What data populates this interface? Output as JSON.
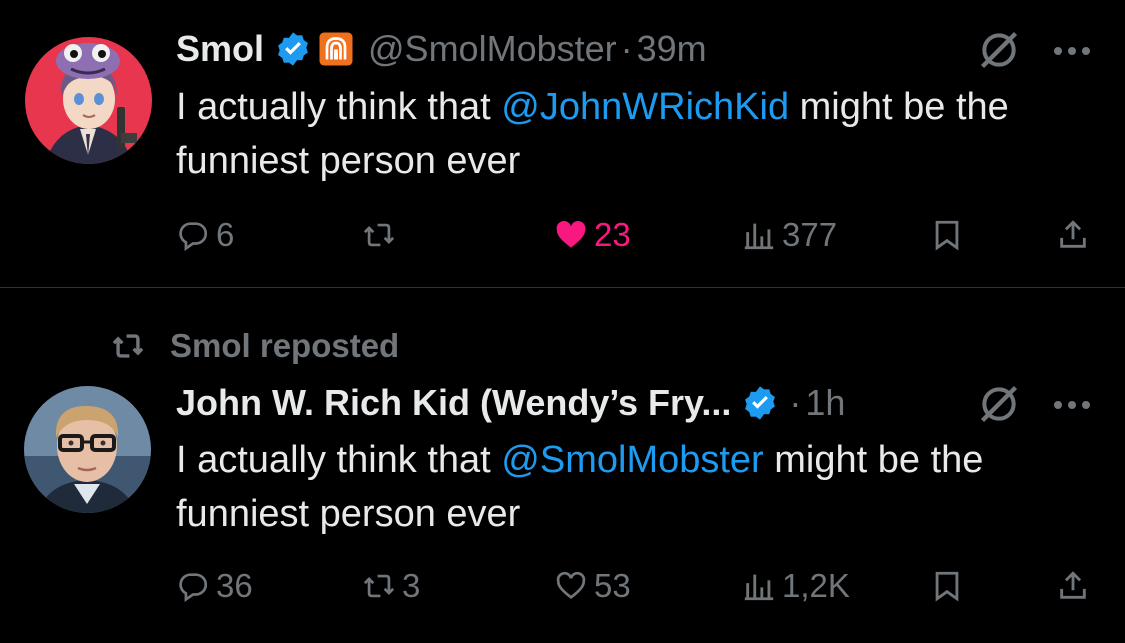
{
  "tweets": [
    {
      "name": "Smol",
      "handle": "@SmolMobster",
      "separator": "·",
      "time": "39m",
      "text_before": "I actually think that ",
      "mention": "@JohnWRichKid",
      "text_after": " might be the funniest person ever",
      "replies": "6",
      "reposts": "",
      "likes": "23",
      "views": "377",
      "liked": true
    },
    {
      "repost_label": "Smol reposted",
      "name": "John W. Rich Kid (Wendy’s Fry...",
      "separator": "·",
      "time": "1h",
      "text_before": "I actually think that ",
      "mention": "@SmolMobster",
      "text_after": " might be the funniest person ever",
      "replies": "36",
      "reposts": "3",
      "likes": "53",
      "views": "1,2K",
      "liked": false
    }
  ],
  "colors": {
    "background": "#000000",
    "text": "#e7e9ea",
    "muted": "#71767b",
    "accent": "#1d9bf0",
    "like": "#f91880",
    "divider": "#2f3336"
  },
  "icons": [
    "verified-badge-icon",
    "affiliate-badge-icon",
    "grok-icon",
    "more-icon",
    "reply-icon",
    "repost-icon",
    "like-icon",
    "views-icon",
    "bookmark-icon",
    "share-icon"
  ]
}
